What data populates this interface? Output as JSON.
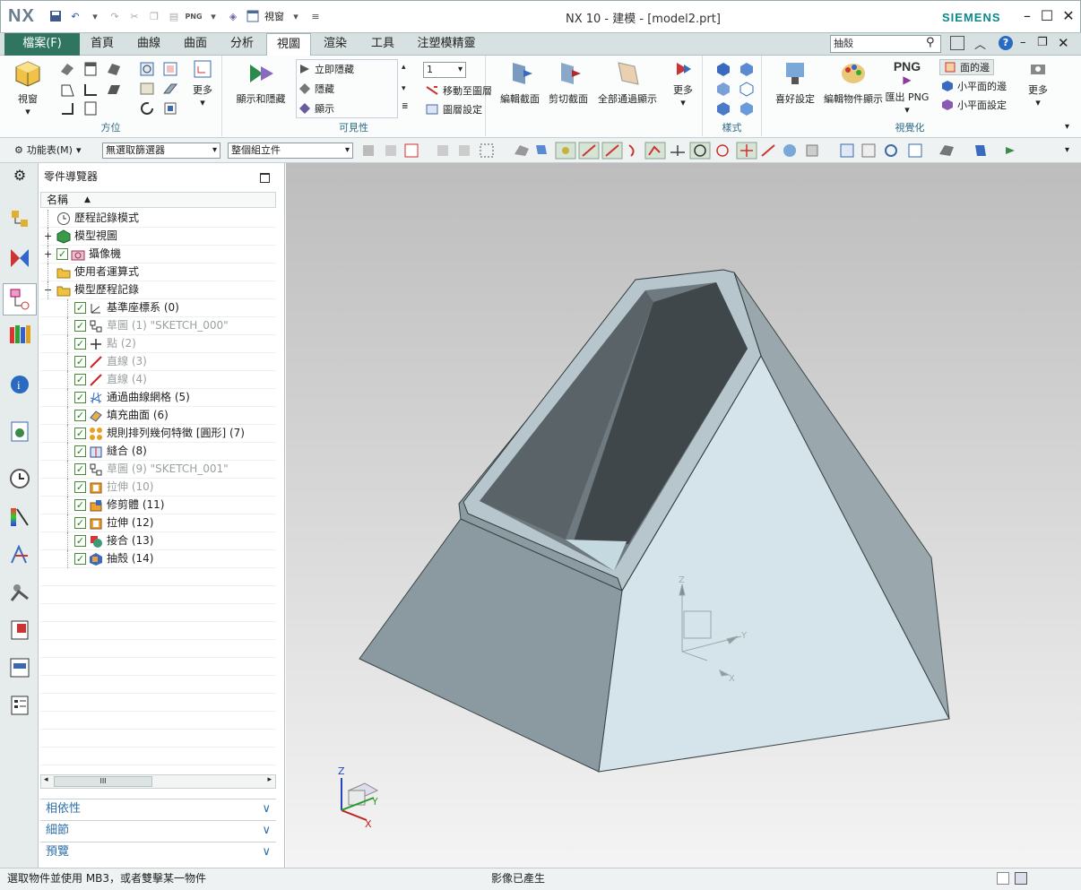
{
  "app": {
    "logo": "NX",
    "title": "NX 10 - 建模 - [model2.prt]",
    "brand": "SIEMENS",
    "window_menu": "視窗"
  },
  "tabs": {
    "file": "檔案(F)",
    "items": [
      "首頁",
      "曲線",
      "曲面",
      "分析",
      "視圖",
      "渲染",
      "工具",
      "注塑模精靈"
    ],
    "active": "視圖",
    "search_value": "抽殼"
  },
  "ribbon": {
    "orient": {
      "label": "方位",
      "view_btn": "視窗",
      "more": "更多"
    },
    "visibility": {
      "label": "可見性",
      "show_hide": "顯示和隱藏",
      "items": [
        "立即隱藏",
        "隱藏",
        "顯示"
      ],
      "layer_value": "1",
      "move_layer": "移動至圖層",
      "layer_settings": "圖層設定"
    },
    "section": {
      "edit": "編輯截面",
      "clip": "剪切截面",
      "all_through": "全部通過顯示",
      "more": "更多"
    },
    "style": {
      "label": "樣式"
    },
    "visualize": {
      "label": "視覺化",
      "prefs": "喜好設定",
      "edit_display": "編輯物件顯示",
      "export": "匯出 PNG",
      "png": "PNG",
      "more": "更多",
      "options": [
        "面的邊",
        "小平面的邊",
        "小平面設定"
      ]
    }
  },
  "toolbar": {
    "menu": "功能表(M)",
    "filter": "無選取篩選器",
    "scope": "整個組立件"
  },
  "navigator": {
    "title": "零件導覽器",
    "col": "名稱",
    "rows": [
      {
        "label": "歷程記錄模式",
        "indent": 0,
        "check": false,
        "gray": false,
        "icon": "clock"
      },
      {
        "label": "模型視圖",
        "indent": 0,
        "check": false,
        "gray": false,
        "icon": "cube",
        "exp": "+"
      },
      {
        "label": "攝像機",
        "indent": 0,
        "check": true,
        "gray": false,
        "icon": "camera",
        "exp": "+"
      },
      {
        "label": "使用者運算式",
        "indent": 0,
        "check": false,
        "gray": false,
        "icon": "folder"
      },
      {
        "label": "模型歷程記錄",
        "indent": 0,
        "check": false,
        "gray": false,
        "icon": "folder",
        "exp": "−"
      },
      {
        "label": "基準座標系 (0)",
        "indent": 1,
        "check": true,
        "gray": false,
        "icon": "csys"
      },
      {
        "label": "草圖 (1) \"SKETCH_000\"",
        "indent": 1,
        "check": true,
        "gray": true,
        "icon": "sketch"
      },
      {
        "label": "點 (2)",
        "indent": 1,
        "check": true,
        "gray": true,
        "icon": "point"
      },
      {
        "label": "直線 (3)",
        "indent": 1,
        "check": true,
        "gray": true,
        "icon": "line"
      },
      {
        "label": "直線 (4)",
        "indent": 1,
        "check": true,
        "gray": true,
        "icon": "line"
      },
      {
        "label": "通過曲線網格 (5)",
        "indent": 1,
        "check": true,
        "gray": false,
        "icon": "mesh"
      },
      {
        "label": "填充曲面 (6)",
        "indent": 1,
        "check": true,
        "gray": false,
        "icon": "fill"
      },
      {
        "label": "規則排列幾何特徵 [圓形] (7)",
        "indent": 1,
        "check": true,
        "gray": false,
        "icon": "pattern"
      },
      {
        "label": "縫合 (8)",
        "indent": 1,
        "check": true,
        "gray": false,
        "icon": "sew"
      },
      {
        "label": "草圖 (9) \"SKETCH_001\"",
        "indent": 1,
        "check": true,
        "gray": true,
        "icon": "sketch"
      },
      {
        "label": "拉伸 (10)",
        "indent": 1,
        "check": true,
        "gray": true,
        "icon": "extrude"
      },
      {
        "label": "修剪體 (11)",
        "indent": 1,
        "check": true,
        "gray": false,
        "icon": "trim"
      },
      {
        "label": "拉伸 (12)",
        "indent": 1,
        "check": true,
        "gray": false,
        "icon": "extrude"
      },
      {
        "label": "接合 (13)",
        "indent": 1,
        "check": true,
        "gray": false,
        "icon": "unite"
      },
      {
        "label": "抽殼 (14)",
        "indent": 1,
        "check": true,
        "gray": false,
        "icon": "shell"
      }
    ],
    "panels": [
      "相依性",
      "細節",
      "預覽"
    ]
  },
  "status": {
    "left": "選取物件並使用 MB3，或者雙擊某一物件",
    "center": "影像已產生"
  },
  "axes": {
    "x": "X",
    "y": "Y",
    "z": "Z"
  }
}
